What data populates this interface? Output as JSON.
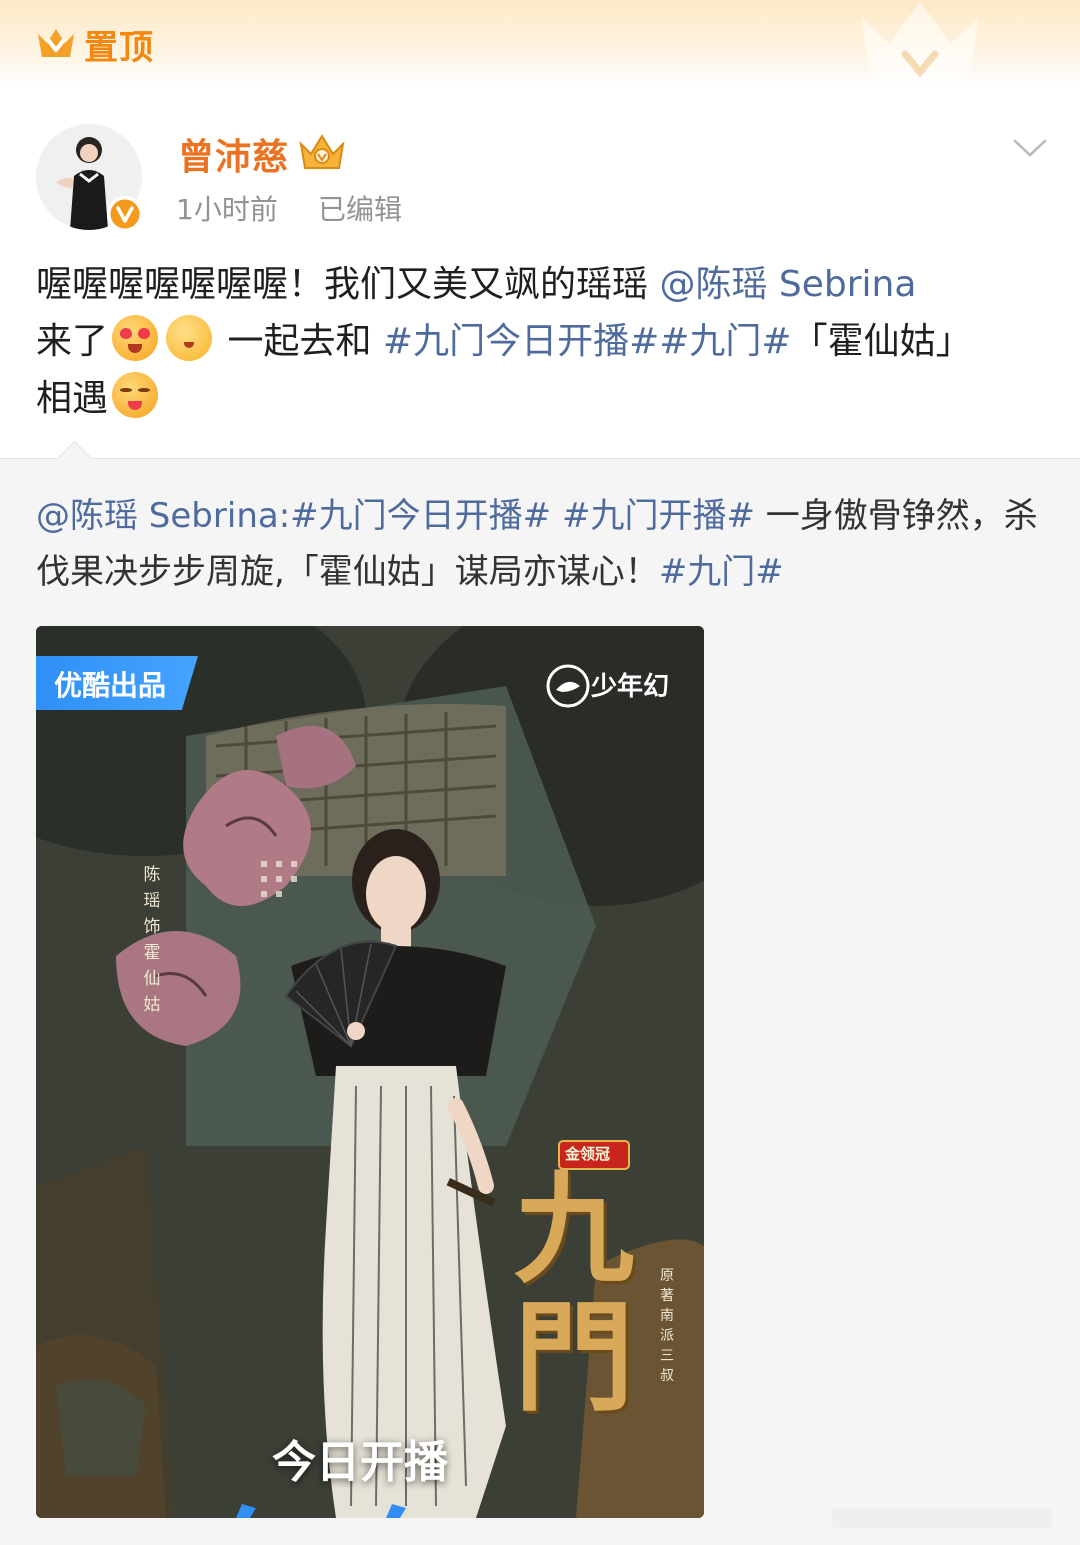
{
  "pin_banner": {
    "label": "置顶",
    "accent": "#f4880f"
  },
  "post": {
    "author": {
      "name": "曾沛慈",
      "name_color": "#eb7220",
      "verified": true
    },
    "meta": {
      "time": "1小时前",
      "edited": "已编辑"
    },
    "text": {
      "part1": "喔喔喔喔喔喔喔！我们又美又飒的瑶瑶 ",
      "mention": "@陈瑶 Sebrina",
      "part2": "来了",
      "part3": " 一起去和 ",
      "hashtag1": "#九门今日开播#",
      "hashtag2": "#九门#",
      "part4": "「霍仙姑」",
      "part5": "相遇"
    },
    "link_color": "#4f6b9d"
  },
  "repost": {
    "mention": "@陈瑶 Sebrina",
    "sep": ":",
    "hashtag1": "#九门今日开播#",
    "space": " ",
    "hashtag2": "#九门开播#",
    "body": " 一身傲骨铮然，杀伐果决步步周旋,「霍仙姑」谋局亦谋心！",
    "hashtag3": "#九门#"
  },
  "poster": {
    "youku_tag": "优酷出品",
    "studio": "少年幻",
    "cast_name": "陈瑶饰霍仙姑",
    "sponsor": "金领冠",
    "title": "九門",
    "author_credit": "原著南派三叔",
    "premiere": "今日开播",
    "youku_color": "#2f8ff5"
  }
}
